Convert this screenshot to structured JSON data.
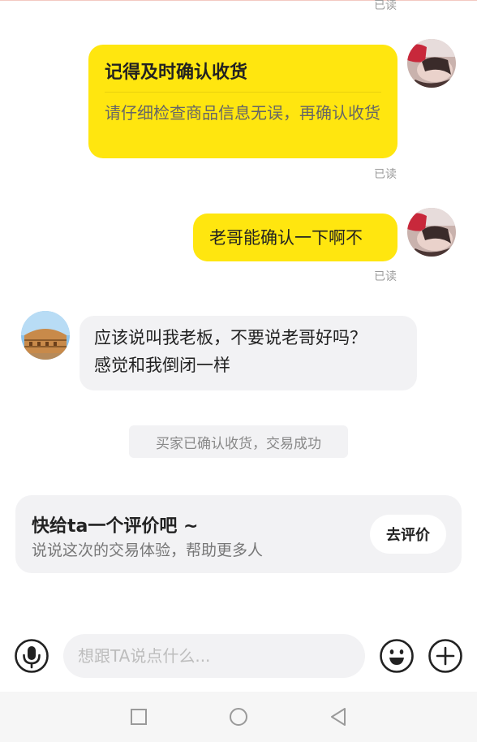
{
  "messages": {
    "read_label": "已读",
    "card": {
      "title": "记得及时确认收货",
      "desc": "请仔细检查商品信息无误，再确认收货"
    },
    "sent_text": "老哥能确认一下啊不",
    "received_text": "应该说叫我老板，不要说老哥好吗？感觉和我倒闭一样"
  },
  "system_note": "买家已确认收货，交易成功",
  "review": {
    "title": "快给ta一个评价吧 ~",
    "subtitle": "说说这次的交易体验，帮助更多人",
    "button": "去评价"
  },
  "input_bar": {
    "placeholder": "想跟TA说点什么...",
    "icons": [
      "microphone-icon",
      "emoji-icon",
      "plus-icon"
    ]
  },
  "nav": {
    "icons": [
      "recent-apps-icon",
      "home-icon",
      "back-icon"
    ]
  },
  "colors": {
    "bubble_yellow": "#ffe60f",
    "bubble_gray": "#f2f2f4",
    "read_gray": "#9a9a9a"
  }
}
